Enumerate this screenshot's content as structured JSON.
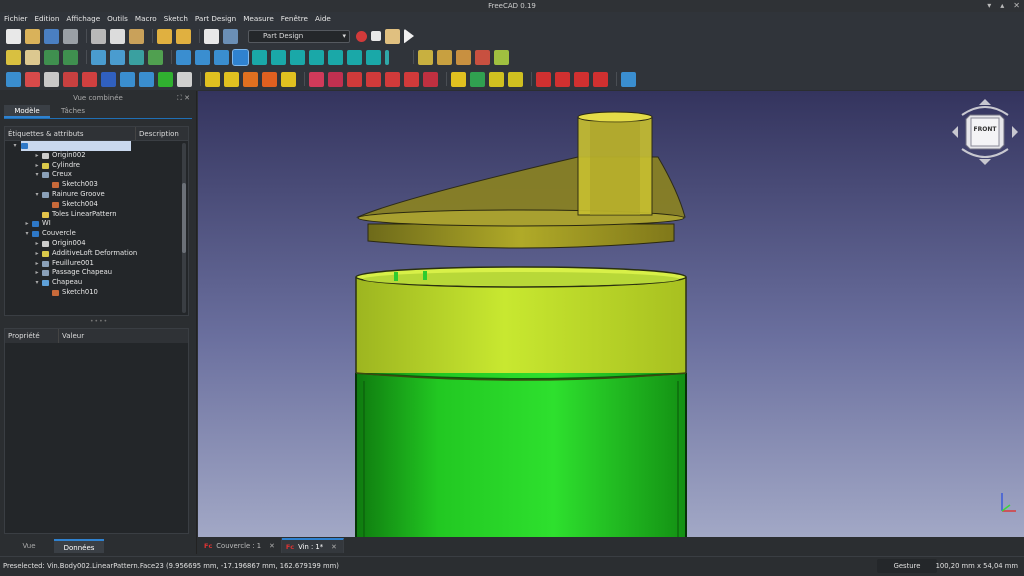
{
  "window": {
    "title": "FreeCAD 0.19"
  },
  "menu": [
    "Fichier",
    "Edition",
    "Affichage",
    "Outils",
    "Macro",
    "Sketch",
    "Part Design",
    "Measure",
    "Fenêtre",
    "Aide"
  ],
  "workbench": {
    "selected": "Part Design"
  },
  "combo_panel": {
    "title": "Vue combinée",
    "tabs": [
      "Modèle",
      "Tâches"
    ],
    "tree_header": {
      "labels_col": "Étiquettes & attributs",
      "desc_col": "Description"
    },
    "tree": [
      {
        "label": "",
        "depth": 0,
        "arrow": "▾",
        "icon": "#2e78c7",
        "selected": true
      },
      {
        "label": "Origin002",
        "depth": 2,
        "arrow": "▸",
        "icon": "#cccccc"
      },
      {
        "label": "Cylindre",
        "depth": 2,
        "arrow": "▸",
        "icon": "#d9c84a"
      },
      {
        "label": "Creux",
        "depth": 2,
        "arrow": "▾",
        "icon": "#8aa0b8"
      },
      {
        "label": "Sketch003",
        "depth": 3,
        "arrow": "",
        "icon": "#c86a3a"
      },
      {
        "label": "Rainure Groove",
        "depth": 2,
        "arrow": "▾",
        "icon": "#8aa0b8"
      },
      {
        "label": "Sketch004",
        "depth": 3,
        "arrow": "",
        "icon": "#c86a3a"
      },
      {
        "label": "Toles LinearPattern",
        "depth": 2,
        "arrow": "",
        "icon": "#e3c34a"
      },
      {
        "label": "WI",
        "depth": 1,
        "arrow": "▸",
        "icon": "#2e78c7"
      },
      {
        "label": "Couvercle",
        "depth": 1,
        "arrow": "▾",
        "icon": "#2e78c7"
      },
      {
        "label": "Origin004",
        "depth": 2,
        "arrow": "▸",
        "icon": "#cccccc"
      },
      {
        "label": "AdditiveLoft Deformation",
        "depth": 2,
        "arrow": "▸",
        "icon": "#d9c84a"
      },
      {
        "label": "Feuillure001",
        "depth": 2,
        "arrow": "▸",
        "icon": "#8aa0b8"
      },
      {
        "label": "Passage Chapeau",
        "depth": 2,
        "arrow": "▸",
        "icon": "#8aa0b8"
      },
      {
        "label": "Chapeau",
        "depth": 2,
        "arrow": "▾",
        "icon": "#5ea0d8"
      },
      {
        "label": "Sketch010",
        "depth": 3,
        "arrow": "",
        "icon": "#c86a3a"
      }
    ],
    "prop_header": {
      "prop_col": "Propriété",
      "value_col": "Valeur"
    },
    "bottom_tabs": [
      "Vue",
      "Données"
    ]
  },
  "view_tabs": [
    {
      "label": "Couvercle : 1",
      "active": false
    },
    {
      "label": "Vin : 1*",
      "active": true
    }
  ],
  "navcube": {
    "face": "FRONT"
  },
  "status": {
    "preselection": "Preselected: Vin.Body002.LinearPattern.Face23 (9.956695 mm, -17.196867 mm, 162.679199 mm)",
    "nav_style": "Gesture",
    "dimensions": "100,20 mm x 54,04 mm"
  },
  "colors": {
    "accent": "#2f82d0",
    "lid_yellow": "#c8c830",
    "body_green": "#22c822",
    "viewport_top": "#34345e",
    "viewport_bottom": "#a2a8c6"
  }
}
